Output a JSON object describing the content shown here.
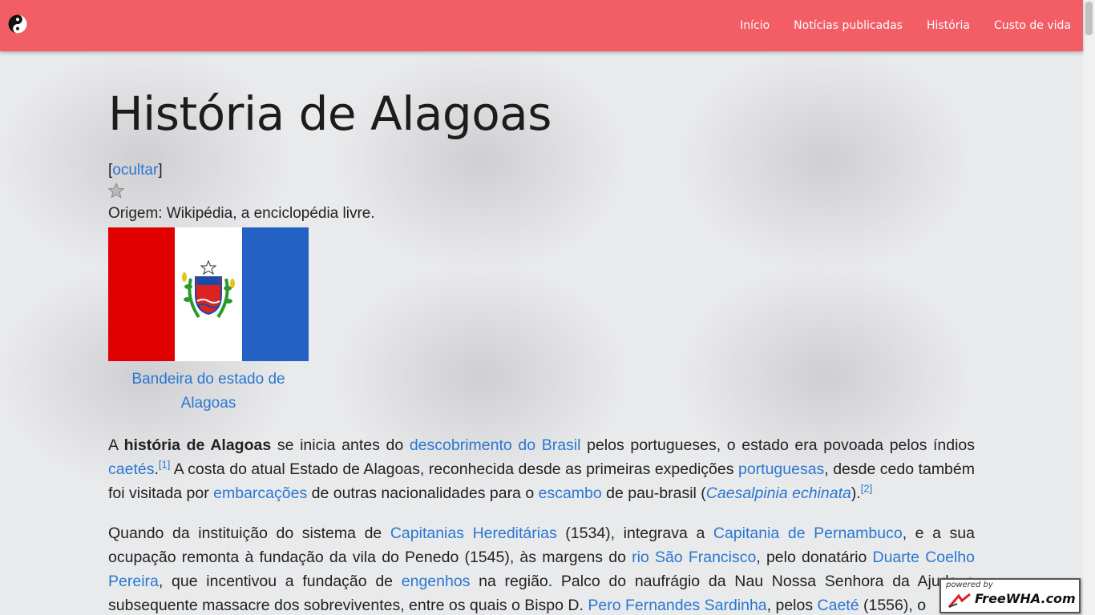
{
  "header": {
    "nav": [
      "Início",
      "Notícias publicadas",
      "História",
      "Custo de vida"
    ]
  },
  "article": {
    "title": "História de Alagoas",
    "toc_toggle": "ocultar",
    "origin": "Origem: Wikipédia, a enciclopédia livre.",
    "flag_caption": "Bandeira do estado de Alagoas",
    "p1": {
      "t1": "A ",
      "b1": "história de Alagoas",
      "t2": " se inicia antes do ",
      "l1": "descobrimento do Brasil",
      "t3": " pelos portugueses, o estado era povoada pelos índios ",
      "l2": "caetés",
      "t4": ".",
      "s1": "[1]",
      "t5": " A costa do atual Estado de Alagoas, reconhecida desde as primeiras expedições ",
      "l3": "portuguesas",
      "t6": ", desde cedo também foi visitada por ",
      "l4": "embarcações",
      "t7": " de outras nacionalidades para o ",
      "l5": "escambo",
      "t8": " de pau-brasil (",
      "l6": "Caesalpinia echinata",
      "t9": ").",
      "s2": "[2]"
    },
    "p2": {
      "t1": "Quando da instituição do sistema de ",
      "l1": "Capitanias Hereditárias",
      "t2": " (1534), integrava a ",
      "l2": "Capitania de Pernambuco",
      "t3": ", e a sua ocupação remonta à fundação da vila do Penedo (1545), às margens do ",
      "l3": "rio São Francisco",
      "t4": ", pelo donatário ",
      "l4": "Duarte Coelho Pereira",
      "t5": ", que incentivou a fundação de ",
      "l5": "engenhos",
      "t6": " na região. Palco do naufrágio da Nau Nossa Senhora da Ajuda e subsequente massacre dos sobreviventes, entre os quais o Bispo D. ",
      "l6": "Pero Fernandes Sardinha",
      "t7": ", pelos ",
      "l7": "Caeté",
      "t8": " (1556), o"
    }
  },
  "badge": {
    "small": "powered by",
    "big": "FreeWHA.com"
  },
  "colors": {
    "header_bg": "#f35d66",
    "link": "#2a77d0",
    "flag_red": "#e10000",
    "flag_blue": "#2362c4"
  },
  "icons": [
    "yin-yang-icon",
    "star-icon"
  ]
}
